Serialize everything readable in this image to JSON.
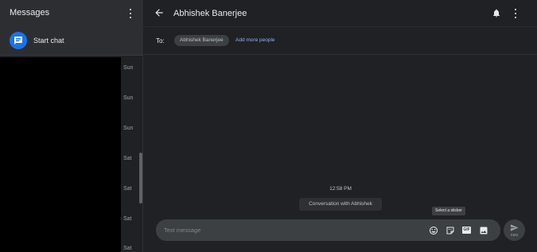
{
  "sidebar": {
    "title": "Messages",
    "start_chat_label": "Start chat",
    "conversation_days": [
      "Sun",
      "Sun",
      "Sun",
      "Sat",
      "Sat",
      "Sat",
      "Sat"
    ]
  },
  "header": {
    "contact_name": "Abhishek Banerjee"
  },
  "recipients": {
    "to_label": "To:",
    "chip": "Abhishek Banerjee",
    "add_more": "Add more people"
  },
  "conversation": {
    "timestamp": "12:58 PM",
    "info_pill": "Conversation with Abhishek"
  },
  "compose": {
    "placeholder": "Text message",
    "tooltip": "Select a sticker",
    "gif_label": "GIF",
    "send_sub_label": "SMS"
  },
  "colors": {
    "background": "#202124",
    "accent_blue": "#1a73e8",
    "link_blue": "#8ab4f8",
    "compose_bg": "#3c4043"
  }
}
